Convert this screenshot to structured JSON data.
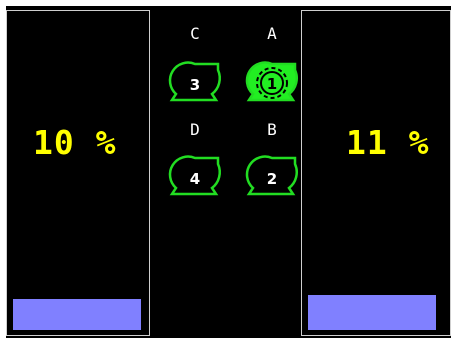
{
  "tanks": [
    {
      "id": "left",
      "label": "10 %",
      "level_percent": 10
    },
    {
      "id": "right",
      "label": "11 %",
      "level_percent": 11
    }
  ],
  "pumps": [
    {
      "letter": "C",
      "number": "3",
      "state": "off"
    },
    {
      "letter": "A",
      "number": "1",
      "state": "running"
    },
    {
      "letter": "D",
      "number": "4",
      "state": "off"
    },
    {
      "letter": "B",
      "number": "2",
      "state": "off"
    }
  ],
  "colors": {
    "background": "#000000",
    "level_text": "#ffff00",
    "level_bar": "#8080ff",
    "pump_outline": "#22dd22",
    "pump_running": "#22ee22",
    "letter": "#ffffff"
  },
  "icons": {
    "pump_off": "pump-icon",
    "pump_running": "pump-running-icon"
  }
}
